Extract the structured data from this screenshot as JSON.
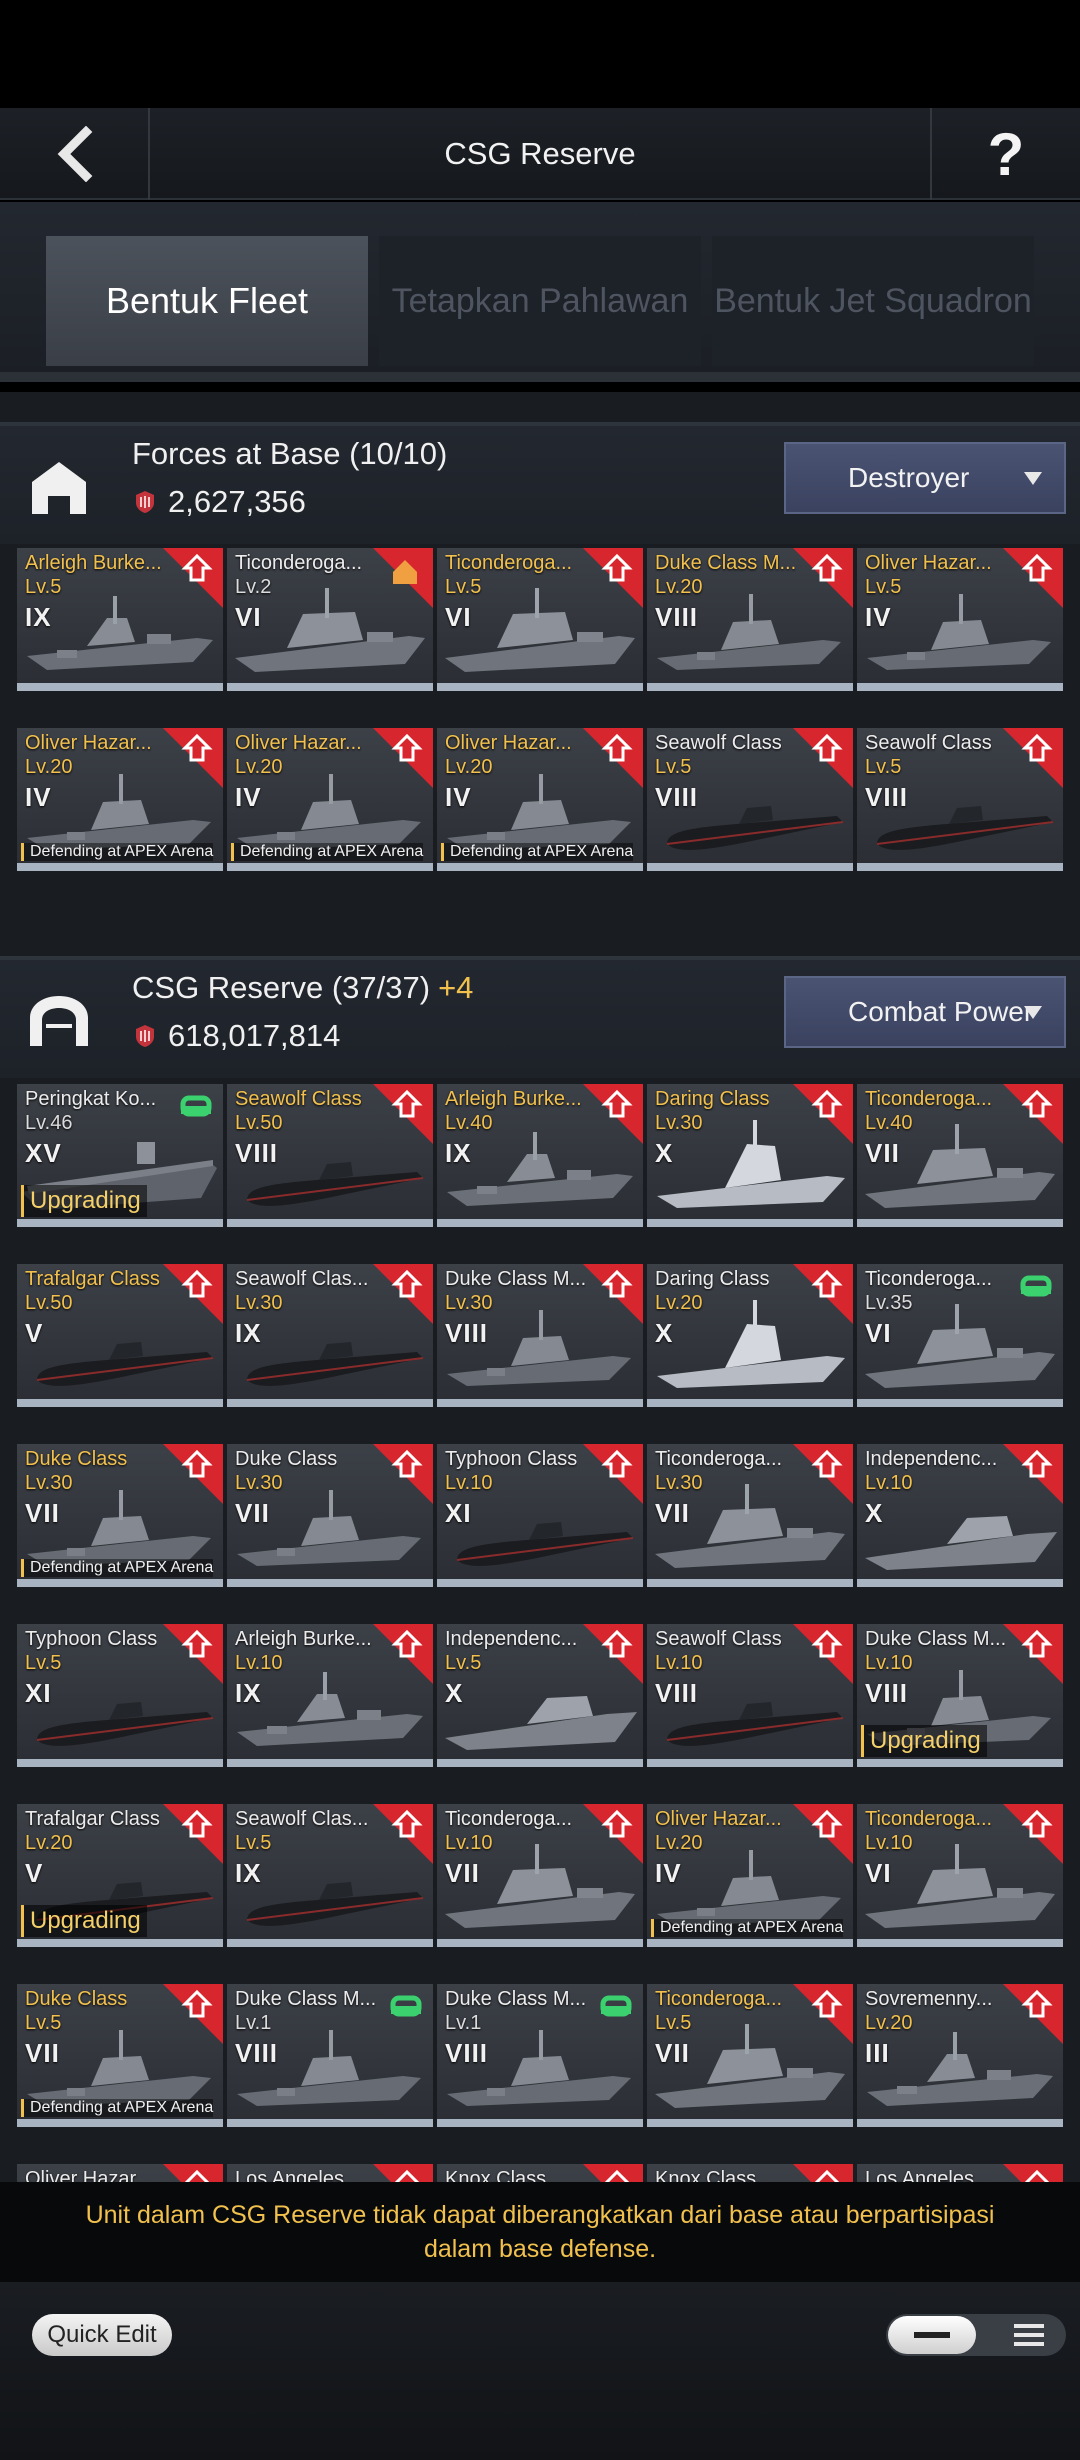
{
  "header": {
    "title": "CSG Reserve",
    "help": "?"
  },
  "tabs": [
    {
      "label": "Bentuk Fleet",
      "active": true
    },
    {
      "label": "Tetapkan Pahlawan",
      "active": false
    },
    {
      "label": "Bentuk Jet Squadron",
      "active": false
    }
  ],
  "base": {
    "title": "Forces at Base (10/10)",
    "power": "2,627,356",
    "sort": "Destroyer",
    "cards": [
      {
        "name": "Arleigh Burke...",
        "level": "Lv.5",
        "tier": "IX",
        "gold": true,
        "ship": "destroyer"
      },
      {
        "name": "Ticonderoga...",
        "level": "Lv.2",
        "tier": "VI",
        "gold": false,
        "ship": "cruiser",
        "badge": "home"
      },
      {
        "name": "Ticonderoga...",
        "level": "Lv.5",
        "tier": "VI",
        "gold": true,
        "ship": "cruiser"
      },
      {
        "name": "Duke Class M...",
        "level": "Lv.20",
        "tier": "VIII",
        "gold": true,
        "ship": "frigate"
      },
      {
        "name": "Oliver Hazar...",
        "level": "Lv.5",
        "tier": "IV",
        "gold": true,
        "ship": "frigate"
      },
      {
        "name": "Oliver Hazar...",
        "level": "Lv.20",
        "tier": "IV",
        "gold": true,
        "ship": "frigate",
        "status": "Defending at APEX Arena"
      },
      {
        "name": "Oliver Hazar...",
        "level": "Lv.20",
        "tier": "IV",
        "gold": true,
        "ship": "frigate",
        "status": "Defending at APEX Arena"
      },
      {
        "name": "Oliver Hazar...",
        "level": "Lv.20",
        "tier": "IV",
        "gold": true,
        "ship": "frigate",
        "status": "Defending at APEX Arena"
      },
      {
        "name": "Seawolf Class",
        "level": "Lv.5",
        "tier": "VIII",
        "gold": false,
        "lvgold": true,
        "ship": "sub"
      },
      {
        "name": "Seawolf Class",
        "level": "Lv.5",
        "tier": "VIII",
        "gold": false,
        "lvgold": true,
        "ship": "sub"
      }
    ]
  },
  "reserve": {
    "title": "CSG Reserve (37/37)",
    "plus": "+4",
    "power": "618,017,814",
    "sort": "Combat Power",
    "cards": [
      {
        "name": "Peringkat Ko...",
        "level": "Lv.46",
        "tier": "XV",
        "gold": false,
        "ship": "carrier",
        "badge": "green",
        "statusBig": "Upgrading"
      },
      {
        "name": "Seawolf Class",
        "level": "Lv.50",
        "tier": "VIII",
        "gold": true,
        "ship": "sub"
      },
      {
        "name": "Arleigh Burke...",
        "level": "Lv.40",
        "tier": "IX",
        "gold": true,
        "ship": "destroyer"
      },
      {
        "name": "Daring Class",
        "level": "Lv.30",
        "tier": "X",
        "gold": true,
        "ship": "daring"
      },
      {
        "name": "Ticonderoga...",
        "level": "Lv.40",
        "tier": "VII",
        "gold": true,
        "ship": "cruiser"
      },
      {
        "name": "Trafalgar Class",
        "level": "Lv.50",
        "tier": "V",
        "gold": true,
        "ship": "sub"
      },
      {
        "name": "Seawolf Clas...",
        "level": "Lv.30",
        "tier": "IX",
        "gold": false,
        "lvgold": true,
        "ship": "sub"
      },
      {
        "name": "Duke Class M...",
        "level": "Lv.30",
        "tier": "VIII",
        "gold": false,
        "lvgold": true,
        "ship": "frigate"
      },
      {
        "name": "Daring Class",
        "level": "Lv.20",
        "tier": "X",
        "gold": false,
        "lvgold": true,
        "ship": "daring"
      },
      {
        "name": "Ticonderoga...",
        "level": "Lv.35",
        "tier": "VI",
        "gold": false,
        "ship": "cruiser",
        "badge": "green"
      },
      {
        "name": "Duke Class",
        "level": "Lv.30",
        "tier": "VII",
        "gold": true,
        "ship": "frigate",
        "status": "Defending at APEX Arena"
      },
      {
        "name": "Duke Class",
        "level": "Lv.30",
        "tier": "VII",
        "gold": false,
        "lvgold": true,
        "ship": "frigate"
      },
      {
        "name": "Typhoon Class",
        "level": "Lv.10",
        "tier": "XI",
        "gold": false,
        "lvgold": true,
        "ship": "sub"
      },
      {
        "name": "Ticonderoga...",
        "level": "Lv.30",
        "tier": "VII",
        "gold": false,
        "lvgold": true,
        "ship": "cruiser"
      },
      {
        "name": "Independenc...",
        "level": "Lv.10",
        "tier": "X",
        "gold": false,
        "lvgold": true,
        "ship": "lcs"
      },
      {
        "name": "Typhoon Class",
        "level": "Lv.5",
        "tier": "XI",
        "gold": false,
        "lvgold": true,
        "ship": "sub"
      },
      {
        "name": "Arleigh Burke...",
        "level": "Lv.10",
        "tier": "IX",
        "gold": false,
        "lvgold": true,
        "ship": "destroyer"
      },
      {
        "name": "Independenc...",
        "level": "Lv.5",
        "tier": "X",
        "gold": false,
        "lvgold": true,
        "ship": "lcs"
      },
      {
        "name": "Seawolf Class",
        "level": "Lv.10",
        "tier": "VIII",
        "gold": false,
        "lvgold": true,
        "ship": "sub"
      },
      {
        "name": "Duke Class M...",
        "level": "Lv.10",
        "tier": "VIII",
        "gold": false,
        "lvgold": true,
        "ship": "frigate",
        "statusBig": "Upgrading"
      },
      {
        "name": "Trafalgar Class",
        "level": "Lv.20",
        "tier": "V",
        "gold": false,
        "lvgold": true,
        "ship": "sub",
        "statusBig": "Upgrading"
      },
      {
        "name": "Seawolf Clas...",
        "level": "Lv.5",
        "tier": "IX",
        "gold": false,
        "lvgold": true,
        "ship": "sub"
      },
      {
        "name": "Ticonderoga...",
        "level": "Lv.10",
        "tier": "VII",
        "gold": false,
        "lvgold": true,
        "ship": "cruiser"
      },
      {
        "name": "Oliver Hazar...",
        "level": "Lv.20",
        "tier": "IV",
        "gold": true,
        "ship": "frigate",
        "status": "Defending at APEX Arena"
      },
      {
        "name": "Ticonderoga...",
        "level": "Lv.10",
        "tier": "VI",
        "gold": true,
        "ship": "cruiser"
      },
      {
        "name": "Duke Class",
        "level": "Lv.5",
        "tier": "VII",
        "gold": true,
        "ship": "frigate",
        "status": "Defending at APEX Arena"
      },
      {
        "name": "Duke Class M...",
        "level": "Lv.1",
        "tier": "VIII",
        "gold": false,
        "ship": "frigate",
        "badge": "green"
      },
      {
        "name": "Duke Class M...",
        "level": "Lv.1",
        "tier": "VIII",
        "gold": false,
        "ship": "frigate",
        "badge": "green"
      },
      {
        "name": "Ticonderoga...",
        "level": "Lv.5",
        "tier": "VII",
        "gold": true,
        "ship": "cruiser"
      },
      {
        "name": "Sovremenny...",
        "level": "Lv.20",
        "tier": "III",
        "gold": false,
        "lvgold": true,
        "ship": "destroyer"
      },
      {
        "name": "Oliver Hazar...",
        "level": "",
        "tier": "",
        "gold": false,
        "ship": "frigate"
      },
      {
        "name": "Los Angeles...",
        "level": "",
        "tier": "",
        "gold": false,
        "ship": "sub"
      },
      {
        "name": "Knox Class",
        "level": "",
        "tier": "",
        "gold": false,
        "ship": "frigate"
      },
      {
        "name": "Knox Class",
        "level": "",
        "tier": "",
        "gold": false,
        "ship": "frigate"
      },
      {
        "name": "Los Angeles...",
        "level": "",
        "tier": "",
        "gold": false,
        "ship": "sub"
      }
    ]
  },
  "notice": "Unit dalam CSG Reserve tidak dapat diberangkatkan dari base atau berpartisipasi dalam base defense.",
  "footer": {
    "quick_edit": "Quick Edit"
  },
  "colors": {
    "gold": "#f2c14d",
    "ribbon": "#d8262e",
    "underbar": "#a9b4c2",
    "dropdown": "#3f4866"
  }
}
